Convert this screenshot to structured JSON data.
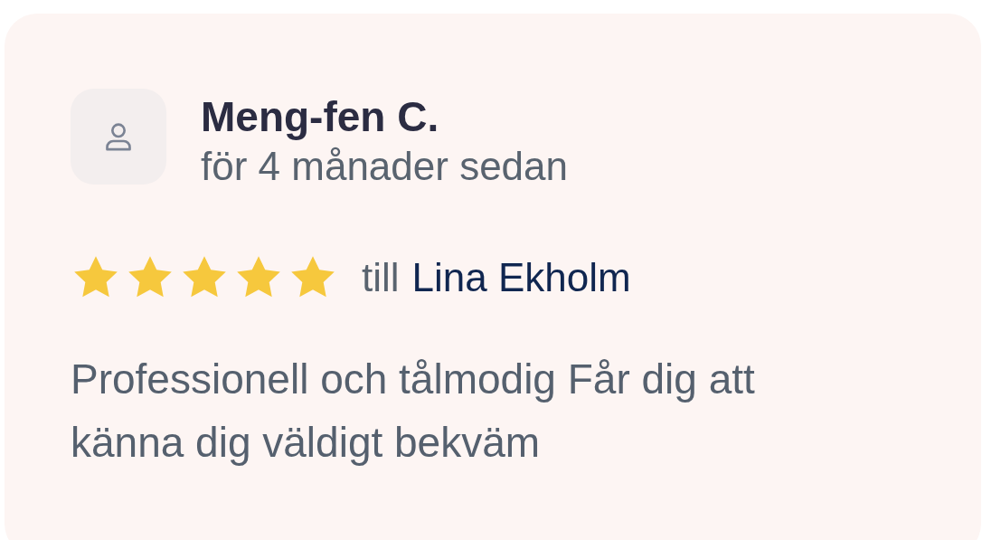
{
  "review": {
    "author": "Meng-fen C.",
    "time": "för 4 månader sedan",
    "stars": 5,
    "recipient_prefix": "till",
    "recipient": "Lina Ekholm",
    "text": "Professionell och tålmodig Får dig att känna dig väldigt bekväm"
  }
}
